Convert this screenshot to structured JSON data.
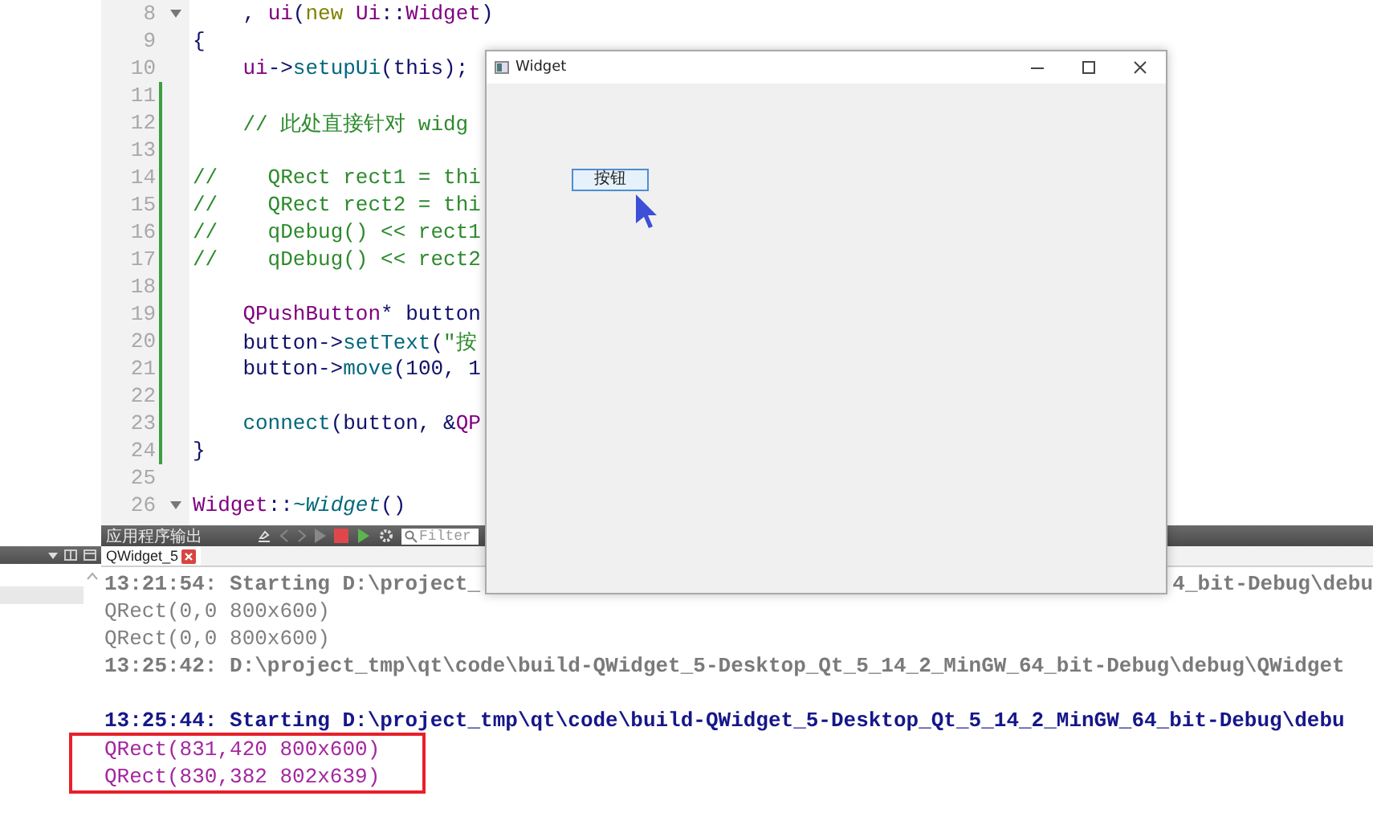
{
  "editor": {
    "lines": [
      {
        "number": "8",
        "modified": false,
        "foldable": true,
        "indented": true,
        "tokens": [
          {
            "kind": "text",
            "text": ", "
          },
          {
            "kind": "field",
            "text": "ui"
          },
          {
            "kind": "text",
            "text": "("
          },
          {
            "kind": "keyword",
            "text": "new"
          },
          {
            "kind": "type",
            "text": "Ui"
          },
          {
            "kind": "text",
            "text": "::"
          },
          {
            "kind": "type",
            "text": "Widget"
          },
          {
            "kind": "text",
            "text": ")"
          }
        ]
      },
      {
        "number": "9",
        "modified": false,
        "foldable": false,
        "indented": false,
        "tokens": [
          {
            "kind": "text",
            "text": "{"
          }
        ]
      },
      {
        "number": "10",
        "modified": false,
        "foldable": false,
        "indented": true,
        "tokens": [
          {
            "kind": "field",
            "text": "ui"
          },
          {
            "kind": "text",
            "text": "->"
          },
          {
            "kind": "func",
            "text": "setupUi"
          },
          {
            "kind": "text",
            "text": "(this);"
          }
        ]
      },
      {
        "number": "11",
        "modified": true,
        "foldable": false,
        "indented": false
      },
      {
        "number": "12",
        "modified": true,
        "foldable": false,
        "indented": true,
        "tokens": [
          {
            "kind": "comment",
            "text": "// 此处直接针对 widg"
          }
        ]
      },
      {
        "number": "13",
        "modified": true,
        "foldable": false,
        "indented": false
      },
      {
        "number": "14",
        "modified": true,
        "foldable": false,
        "indented": false,
        "tokens": [
          {
            "kind": "comment",
            "text": "//    QRect rect1 = thi"
          }
        ]
      },
      {
        "number": "15",
        "modified": true,
        "foldable": false,
        "indented": false,
        "tokens": [
          {
            "kind": "comment",
            "text": "//    QRect rect2 = thi"
          }
        ]
      },
      {
        "number": "16",
        "modified": true,
        "foldable": false,
        "indented": false,
        "tokens": [
          {
            "kind": "comment",
            "text": "//    qDebug() << rect1"
          }
        ]
      },
      {
        "number": "17",
        "modified": true,
        "foldable": false,
        "indented": false,
        "tokens": [
          {
            "kind": "comment",
            "text": "//    qDebug() << rect2"
          }
        ]
      },
      {
        "number": "18",
        "modified": true,
        "foldable": false,
        "indented": false
      },
      {
        "number": "19",
        "modified": true,
        "foldable": false,
        "indented": true,
        "tokens": [
          {
            "kind": "type",
            "text": "QPushButton"
          },
          {
            "kind": "text",
            "text": "* button"
          }
        ]
      },
      {
        "number": "20",
        "modified": true,
        "foldable": false,
        "indented": true,
        "tokens": [
          {
            "kind": "text",
            "text": "button->"
          },
          {
            "kind": "func",
            "text": "setText"
          },
          {
            "kind": "text",
            "text": "("
          },
          {
            "kind": "string",
            "text": "\"按"
          }
        ]
      },
      {
        "number": "21",
        "modified": true,
        "foldable": false,
        "indented": true,
        "tokens": [
          {
            "kind": "text",
            "text": "button->"
          },
          {
            "kind": "func",
            "text": "move"
          },
          {
            "kind": "text",
            "text": "(100, 1"
          }
        ]
      },
      {
        "number": "22",
        "modified": true,
        "foldable": false,
        "indented": false
      },
      {
        "number": "23",
        "modified": true,
        "foldable": false,
        "indented": true,
        "tokens": [
          {
            "kind": "func",
            "text": "connect"
          },
          {
            "kind": "text",
            "text": "(button, &"
          },
          {
            "kind": "type",
            "text": "QP"
          }
        ]
      },
      {
        "number": "24",
        "modified": true,
        "foldable": false,
        "indented": false,
        "tokens": [
          {
            "kind": "text",
            "text": "}"
          }
        ]
      },
      {
        "number": "25",
        "modified": false,
        "foldable": false,
        "indented": false
      },
      {
        "number": "26",
        "modified": false,
        "foldable": true,
        "indented": false,
        "tokens": [
          {
            "kind": "type",
            "text": "Widget"
          },
          {
            "kind": "text",
            "text": "::"
          },
          {
            "kind": "italic_func",
            "text": "~Widget"
          },
          {
            "kind": "text",
            "text": "()"
          }
        ]
      }
    ]
  },
  "side_panel": {
    "items": [
      {
        "selected": true
      }
    ]
  },
  "output_pane": {
    "title": "应用程序输出",
    "filter": {
      "placeholder": "Filter"
    },
    "tabs": [
      {
        "label": "QWidget_5",
        "selected": true
      }
    ],
    "lines": [
      {
        "kind": "system",
        "highlighted": false,
        "text": "13:21:54: Starting D:\\project_",
        "tail": "4_bit-Debug\\debu"
      },
      {
        "kind": "stdout",
        "highlighted": false,
        "text": "QRect(0,0 800x600)"
      },
      {
        "kind": "stdout",
        "highlighted": false,
        "text": "QRect(0,0 800x600)"
      },
      {
        "kind": "system",
        "highlighted": false,
        "text": "13:25:42: D:\\project_tmp\\qt\\code\\build-QWidget_5-Desktop_Qt_5_14_2_MinGW_64_bit-Debug\\debug\\QWidget"
      },
      {
        "kind": "start",
        "highlighted": false,
        "gap_before": true,
        "text": "13:25:44: Starting D:\\project_tmp\\qt\\code\\build-QWidget_5-Desktop_Qt_5_14_2_MinGW_64_bit-Debug\\debu"
      },
      {
        "kind": "debug",
        "highlighted": true,
        "text": "QRect(831,420 800x600)"
      },
      {
        "kind": "debug",
        "highlighted": true,
        "text": "QRect(830,382 802x639)"
      }
    ]
  },
  "widget_window": {
    "title": "Widget",
    "button": {
      "label": "按钮"
    }
  }
}
